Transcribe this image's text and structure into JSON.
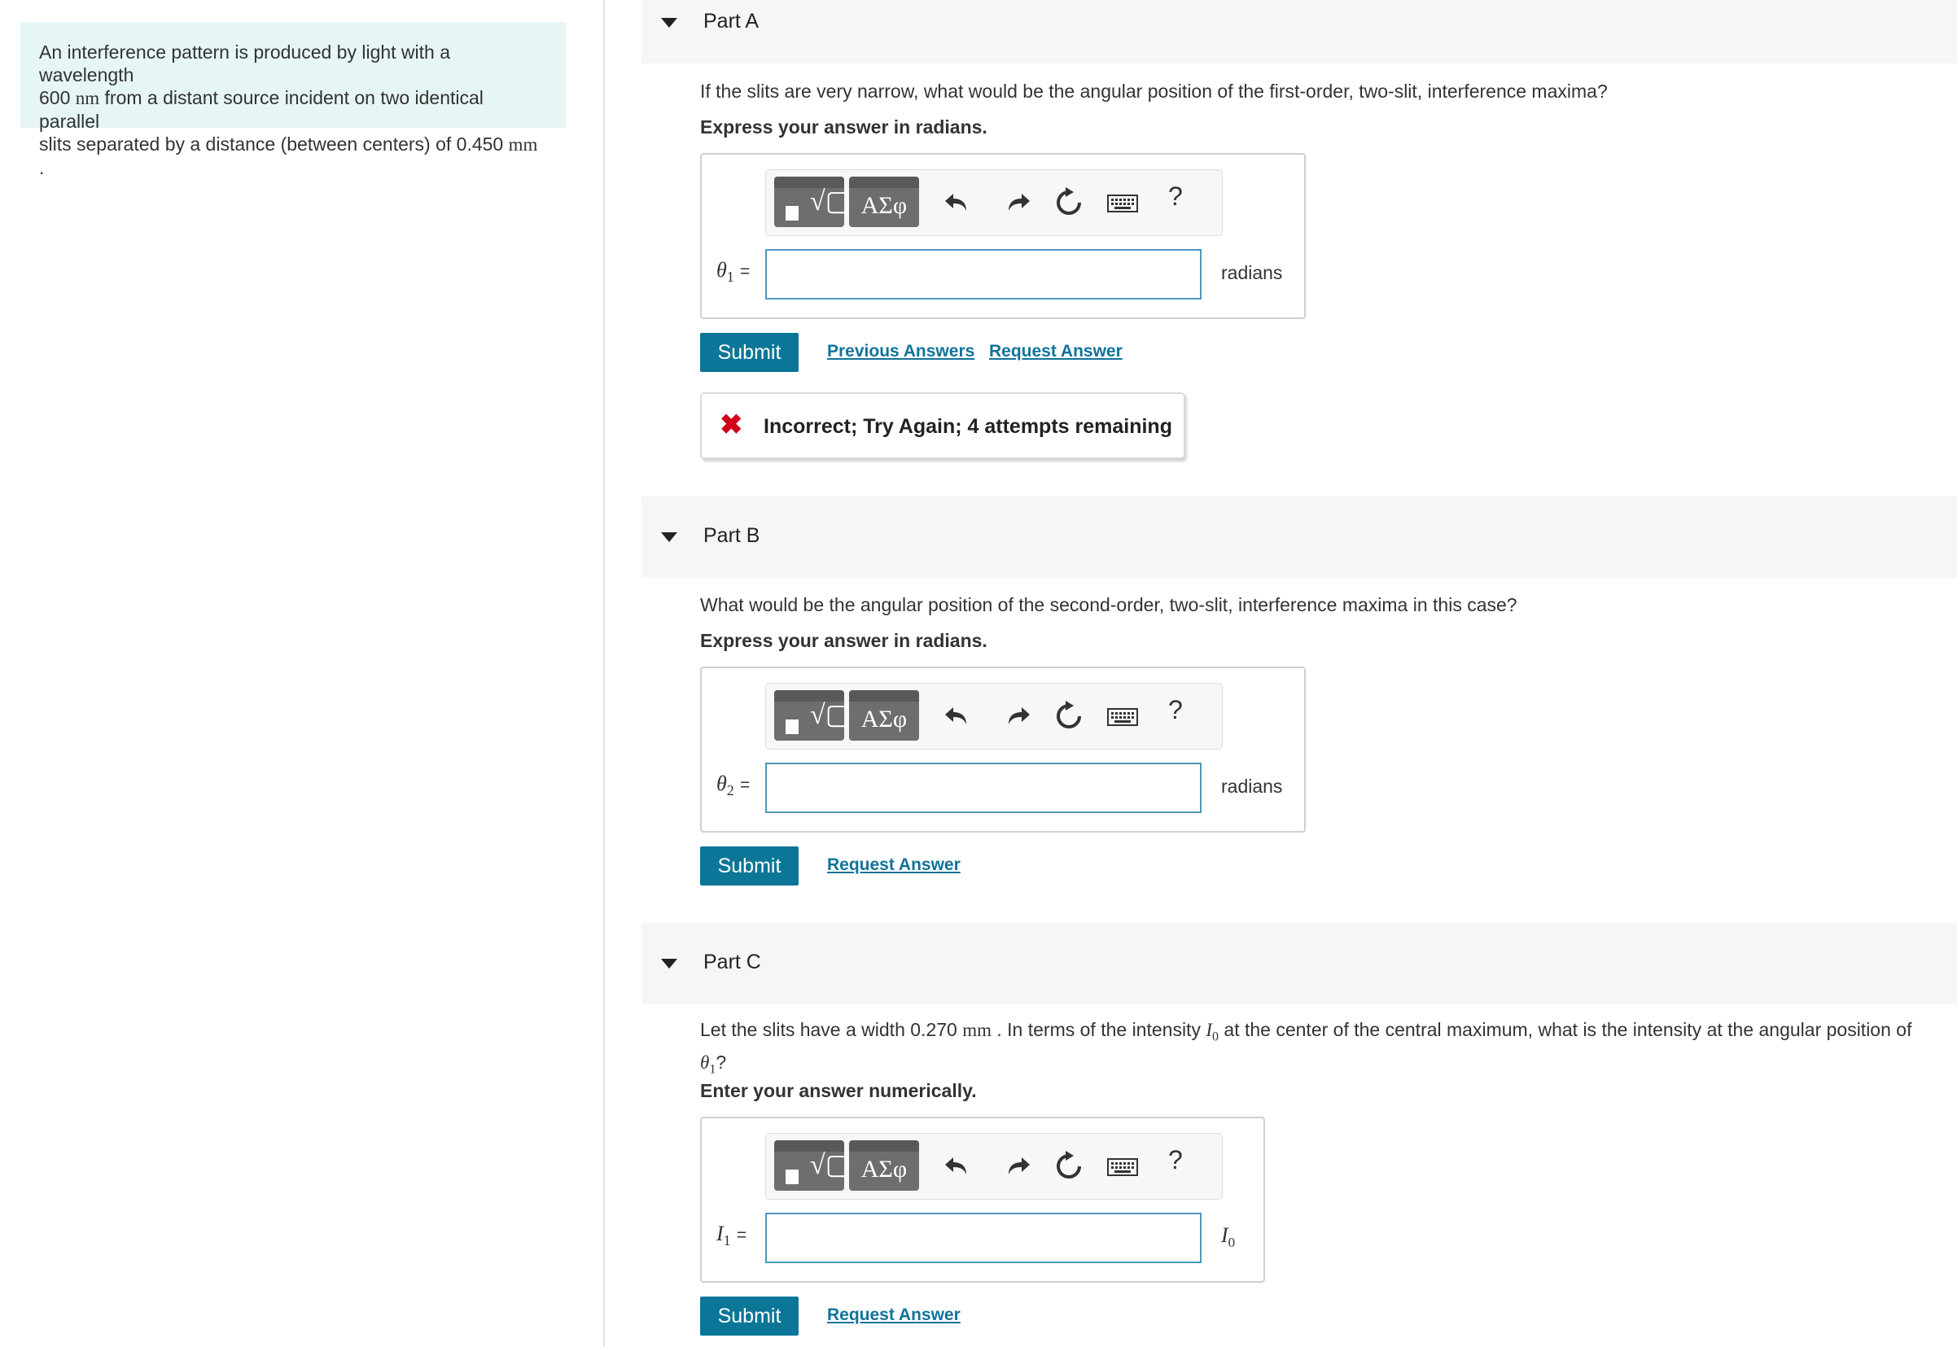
{
  "intro": {
    "t1": "An interference pattern is produced by light with a wavelength",
    "t2_num": "600",
    "t2_unit": "nm",
    "t2_rest": "from a distant source incident on two identical parallel",
    "t3": "slits separated by a distance (between centers) of",
    "t3_num": "0.450",
    "t3_unit": "mm",
    "t3_end": "."
  },
  "toolbar": {
    "templates_icon": "fraction-root-icon",
    "greek_label": "ΑΣφ",
    "undo_icon": "undo-icon",
    "redo_icon": "redo-icon",
    "reset_icon": "reset-icon",
    "keyboard_icon": "keyboard-icon",
    "help_label": "?"
  },
  "submit_label": "Submit",
  "request_answer_label": "Request Answer",
  "previous_answers_label": "Previous Answers",
  "parts": [
    {
      "title": "Part A",
      "question": "If the slits are very narrow, what would be the angular position of the first-order, two-slit, interference maxima?",
      "instruction": "Express your answer in radians.",
      "var_sym": "θ",
      "var_sub": "1",
      "eq": "=",
      "input_value": "",
      "unit": "radians",
      "feedback": "Incorrect; Try Again; 4 attempts remaining"
    },
    {
      "title": "Part B",
      "question": "What would be the angular position of the second-order, two-slit, interference maxima in this case?",
      "instruction": "Express your answer in radians.",
      "var_sym": "θ",
      "var_sub": "2",
      "eq": "=",
      "input_value": "",
      "unit": "radians"
    },
    {
      "title": "Part C",
      "q1": "Let the slits have a width",
      "q_num": "0.270",
      "q_unit": "mm",
      "q2": ". In terms of the intensity",
      "q_I": "I",
      "q_I_sub": "0",
      "q3": "at the center of the central maximum, what is the intensity at the angular position of",
      "q_theta": "θ",
      "q_theta_sub": "1",
      "q4": "?",
      "instruction": "Enter your answer numerically.",
      "var_sym": "I",
      "var_sub": "1",
      "eq": "=",
      "input_value": "",
      "unit_sym": "I",
      "unit_sub": "0"
    }
  ]
}
